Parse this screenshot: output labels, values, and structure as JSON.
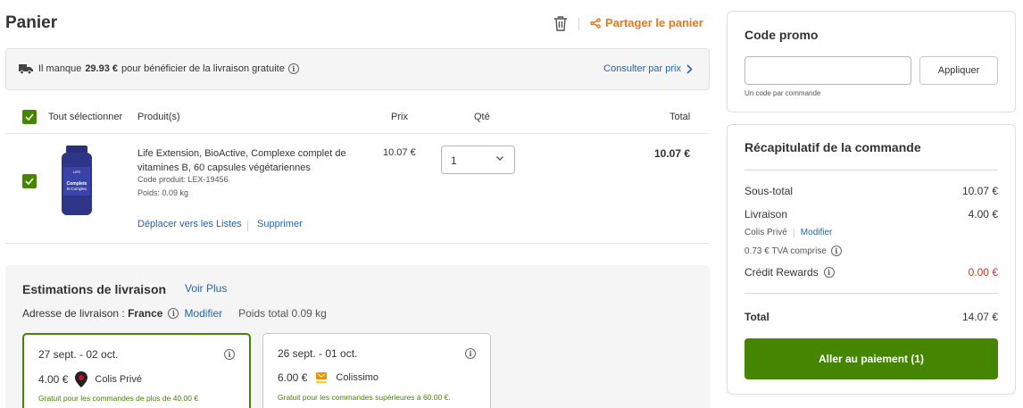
{
  "header": {
    "title": "Panier",
    "share_label": "Partager le panier"
  },
  "banner": {
    "prefix": "Il manque",
    "amount": "29.93 €",
    "suffix": "pour bénéficier de la livraison gratuite",
    "link": "Consulter par prix"
  },
  "table": {
    "select_all": "Tout sélectionner",
    "col_product": "Produit(s)",
    "col_price": "Prix",
    "col_qty": "Qté",
    "col_total": "Total"
  },
  "product": {
    "name": "Life Extension, BioActive, Complexe complet de vitamines B, 60 capsules végétariennes",
    "code": "Code produit: LEX-19456",
    "weight": "Poids: 0.09 kg",
    "price": "10.07 €",
    "qty": "1",
    "total": "10.07 €",
    "move_link": "Déplacer vers les Listes",
    "delete_link": "Supprimer",
    "image_label": "Complete B-Complex"
  },
  "shipping": {
    "title": "Estimations de livraison",
    "more": "Voir Plus",
    "address_label": "Adresse de livraison :",
    "address_country": "France",
    "modify": "Modifier",
    "weight": "Poids total 0.09 kg",
    "options": [
      {
        "date": "27 sept. - 02 oct.",
        "price": "4.00 €",
        "carrier": "Colis Privé",
        "note": "Gratuit pour les commandes de plus de 40.00 €",
        "selected": true
      },
      {
        "date": "26 sept. - 01 oct.",
        "price": "6.00 €",
        "carrier": "Colissimo",
        "note": "Gratuit pour les commandes supérieures à 60.00 €.",
        "selected": false
      }
    ]
  },
  "promo": {
    "title": "Code promo",
    "input_value": "",
    "apply": "Appliquer",
    "hint": "Un code par commande"
  },
  "summary": {
    "title": "Récapitulatif de la commande",
    "subtotal_label": "Sous-total",
    "subtotal": "10.07 €",
    "delivery_label": "Livraison",
    "delivery": "4.00 €",
    "carrier": "Colis Privé",
    "carrier_modify": "Modifier",
    "vat": "0.73 € TVA comprise",
    "rewards_label": "Crédit Rewards",
    "rewards": "0.00 €",
    "total_label": "Total",
    "total": "14.07 €",
    "checkout": "Aller au paiement (1)"
  },
  "colors": {
    "accent_green": "#458500",
    "link_blue": "#2664a8",
    "share_orange": "#e8761c",
    "rewards_red": "#c0392b"
  }
}
